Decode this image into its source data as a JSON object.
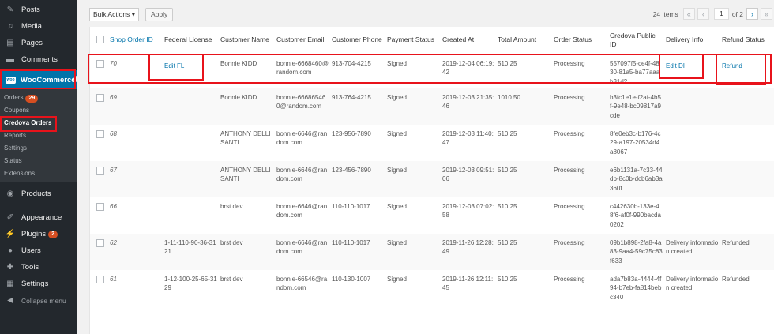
{
  "sidebar": {
    "items": [
      {
        "label": "Posts",
        "icon": "pin-icon"
      },
      {
        "label": "Media",
        "icon": "media-icon"
      },
      {
        "label": "Pages",
        "icon": "pages-icon"
      },
      {
        "label": "Comments",
        "icon": "comments-icon"
      },
      {
        "label": "WooCommerce",
        "icon": "woo-icon"
      }
    ],
    "submenu": [
      {
        "label": "Orders",
        "badge": "29"
      },
      {
        "label": "Coupons"
      },
      {
        "label": "Credova Orders"
      },
      {
        "label": "Reports"
      },
      {
        "label": "Settings"
      },
      {
        "label": "Status"
      },
      {
        "label": "Extensions"
      }
    ],
    "lower": [
      {
        "label": "Products",
        "icon": "products-icon"
      },
      {
        "label": "Appearance",
        "icon": "appearance-icon"
      },
      {
        "label": "Plugins",
        "icon": "plugins-icon",
        "badge": "2"
      },
      {
        "label": "Users",
        "icon": "users-icon"
      },
      {
        "label": "Tools",
        "icon": "tools-icon"
      },
      {
        "label": "Settings",
        "icon": "settings-icon"
      },
      {
        "label": "Collapse menu",
        "icon": "collapse-icon"
      }
    ],
    "woo_logo_text": "woo"
  },
  "toolbar": {
    "bulk_label": "Bulk Actions",
    "apply_label": "Apply",
    "items_count": "24 items",
    "first": "«",
    "prev": "‹",
    "page": "1",
    "of": "of 2",
    "next": "›",
    "last": "»"
  },
  "table": {
    "columns": [
      "Shop Order ID",
      "Federal License",
      "Customer Name",
      "Customer Email",
      "Customer Phone",
      "Payment Status",
      "Created At",
      "Total Amount",
      "Order Status",
      "Credova Public ID",
      "Delivery Info",
      "Refund Status"
    ],
    "rows": [
      {
        "id": "70",
        "license": "Edit FL",
        "name": "Bonnie KIDD",
        "email": "bonnie-6668460@random.com",
        "phone": "913-704-4215",
        "payment": "Signed",
        "created": "2019-12-04 06:19:42",
        "total": "510.25",
        "status": "Processing",
        "public_id": "557097f5-ce4f-4830-81a5-ba77aaab31d2",
        "delivery": "Edit DI",
        "refund": "Refund"
      },
      {
        "id": "69",
        "license": "",
        "name": "Bonnie KIDD",
        "email": "bonnie-666865460@random.com",
        "phone": "913-764-4215",
        "payment": "Signed",
        "created": "2019-12-03 21:35:46",
        "total": "1010.50",
        "status": "Processing",
        "public_id": "b3fc1e1e-f2af-4b5f-9e48-bc09817a9cde",
        "delivery": "",
        "refund": ""
      },
      {
        "id": "68",
        "license": "",
        "name": "ANTHONY DELLISANTI",
        "email": "bonnie-6646@random.com",
        "phone": "123-956-7890",
        "payment": "Signed",
        "created": "2019-12-03 11:40:47",
        "total": "510.25",
        "status": "Processing",
        "public_id": "8fe0eb3c-b176-4c29-a197-20534d4a8067",
        "delivery": "",
        "refund": ""
      },
      {
        "id": "67",
        "license": "",
        "name": "ANTHONY DELLISANTI",
        "email": "bonnie-6646@random.com",
        "phone": "123-456-7890",
        "payment": "Signed",
        "created": "2019-12-03 09:51:06",
        "total": "510.25",
        "status": "Processing",
        "public_id": "e6b1131a-7c33-44db-8c0b-dcb6ab3a360f",
        "delivery": "",
        "refund": ""
      },
      {
        "id": "66",
        "license": "",
        "name": "brst dev",
        "email": "bonnie-6646@random.com",
        "phone": "110-110-1017",
        "payment": "Signed",
        "created": "2019-12-03 07:02:58",
        "total": "510.25",
        "status": "Processing",
        "public_id": "c442630b-133e-48f6-af0f-990bacda0202",
        "delivery": "",
        "refund": ""
      },
      {
        "id": "62",
        "license": "1-11-110-90-36-3121",
        "name": "brst dev",
        "email": "bonnie-6646@random.com",
        "phone": "110-110-1017",
        "payment": "Signed",
        "created": "2019-11-26 12:28:49",
        "total": "510.25",
        "status": "Processing",
        "public_id": "09b1b898-2fa8-4a83-9aa4-59c75c83f633",
        "delivery": "Delivery information created",
        "refund": "Refunded"
      },
      {
        "id": "61",
        "license": "1-12-100-25-65-3129",
        "name": "brst dev",
        "email": "bonnie-66546@random.com",
        "phone": "110-130-1007",
        "payment": "Signed",
        "created": "2019-11-26 12:11:45",
        "total": "510.25",
        "status": "Processing",
        "public_id": "ada7b83a-4444-4f94-b7eb-fa814bebc340",
        "delivery": "Delivery information created",
        "refund": "Refunded"
      }
    ]
  },
  "colors": {
    "sidebar": "#23282d",
    "active": "#0073aa",
    "highlight": "#e8131b",
    "badge": "#d54e21"
  }
}
